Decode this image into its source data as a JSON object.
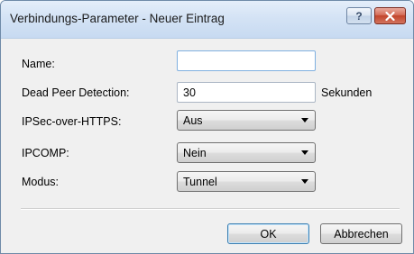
{
  "window": {
    "title": "Verbindungs-Parameter - Neuer Eintrag",
    "help_glyph": "?",
    "close_glyph": "x"
  },
  "form": {
    "name": {
      "label": "Name:",
      "value": ""
    },
    "dpd": {
      "label": "Dead Peer Detection:",
      "value": "30",
      "unit": "Sekunden"
    },
    "ipsec_over_https": {
      "label": "IPSec-over-HTTPS:",
      "selected": "Aus"
    },
    "ipcomp": {
      "label": "IPCOMP:",
      "selected": "Nein"
    },
    "modus": {
      "label": "Modus:",
      "selected": "Tunnel"
    }
  },
  "buttons": {
    "ok": "OK",
    "cancel": "Abbrechen"
  }
}
